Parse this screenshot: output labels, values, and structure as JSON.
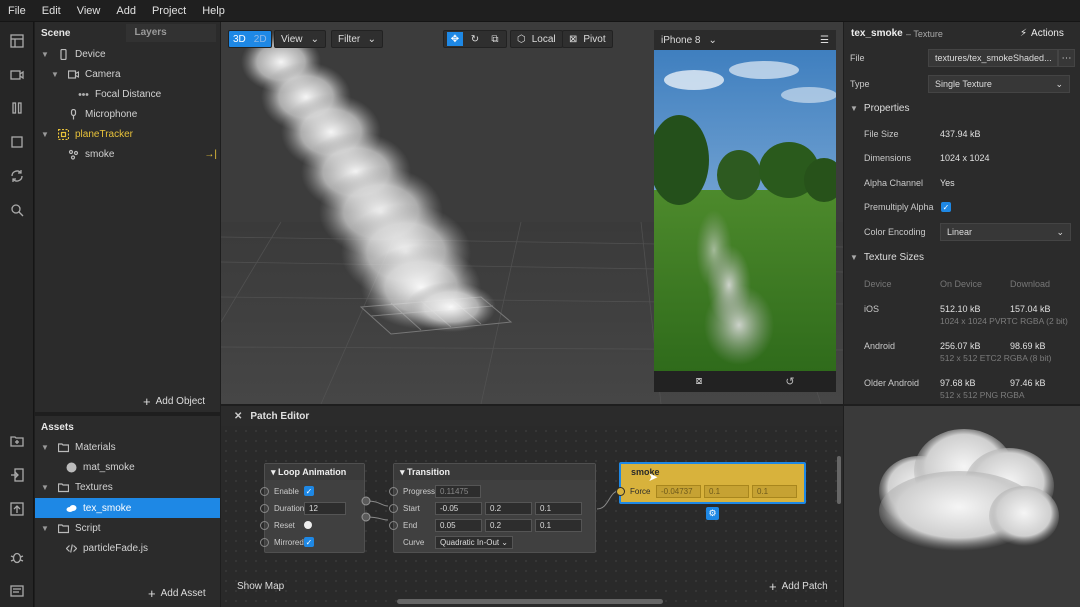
{
  "menu": [
    "File",
    "Edit",
    "View",
    "Add",
    "Project",
    "Help"
  ],
  "scene": {
    "tab_active": "Scene",
    "tab_inactive": "Layers",
    "items": [
      {
        "label": "Device"
      },
      {
        "label": "Camera"
      },
      {
        "label": "Focal Distance"
      },
      {
        "label": "Microphone"
      },
      {
        "label": "planeTracker"
      },
      {
        "label": "smoke"
      }
    ],
    "add_label": "Add Object"
  },
  "assets": {
    "title": "Assets",
    "items": [
      {
        "label": "Materials"
      },
      {
        "label": "mat_smoke"
      },
      {
        "label": "Textures"
      },
      {
        "label": "tex_smoke"
      },
      {
        "label": "Script"
      },
      {
        "label": "particleFade.js"
      }
    ],
    "add_label": "Add Asset"
  },
  "viewport": {
    "mode_3d": "3D",
    "mode_2d": "2D",
    "view_label": "View",
    "filter_label": "Filter",
    "local_label": "Local",
    "pivot_label": "Pivot",
    "device_label": "iPhone 8"
  },
  "patch_editor": {
    "title": "Patch Editor",
    "show_map": "Show Map",
    "add_patch": "Add Patch",
    "loop": {
      "title": "Loop Animation",
      "enable": "Enable",
      "duration": "Duration",
      "duration_value": "12",
      "reset": "Reset",
      "mirrored": "Mirrored"
    },
    "transition": {
      "title": "Transition",
      "progress": "Progress",
      "progress_value": "0.11475",
      "start": "Start",
      "start_values": [
        "-0.05",
        "0.2",
        "0.1"
      ],
      "end": "End",
      "end_values": [
        "0.05",
        "0.2",
        "0.1"
      ],
      "curve": "Curve",
      "curve_value": "Quadratic In-Out"
    },
    "smoke": {
      "title": "smoke",
      "force": "Force",
      "force_values": [
        "-0.04737",
        "0.1",
        "0.1"
      ]
    }
  },
  "inspector": {
    "name": "tex_smoke",
    "type_label": "– Texture",
    "actions": "Actions",
    "file_label": "File",
    "file_value": "textures/tex_smokeShaded...",
    "type_field_label": "Type",
    "type_value": "Single Texture",
    "properties_title": "Properties",
    "file_size_label": "File Size",
    "file_size_value": "437.94 kB",
    "dimensions_label": "Dimensions",
    "dimensions_value": "1024 x 1024",
    "alpha_label": "Alpha Channel",
    "alpha_value": "Yes",
    "premultiply_label": "Premultiply Alpha",
    "encoding_label": "Color Encoding",
    "encoding_value": "Linear",
    "texture_sizes_title": "Texture Sizes",
    "col_device": "Device",
    "col_on_device": "On Device",
    "col_download": "Download",
    "rows": [
      {
        "device": "iOS",
        "on_device": "512.10 kB",
        "download": "157.04 kB",
        "detail": "1024 x 1024 PVRTC RGBA (2 bit)"
      },
      {
        "device": "Android",
        "on_device": "256.07 kB",
        "download": "98.69 kB",
        "detail": "512 x 512 ETC2 RGBA (8 bit)"
      },
      {
        "device": "Older Android",
        "on_device": "97.68 kB",
        "download": "97.46 kB",
        "detail": "512 x 512 PNG RGBA"
      }
    ]
  },
  "colors": {
    "accent": "#1e88e5",
    "tracker_yellow": "#e8c23a",
    "patch_yellow": "#d8b23c"
  }
}
